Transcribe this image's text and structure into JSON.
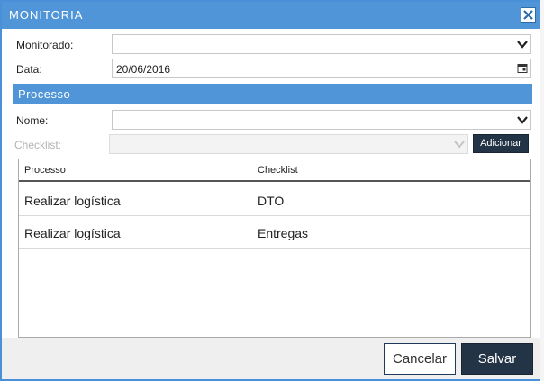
{
  "dialog": {
    "title": "MONITORIA",
    "close_icon": "close-icon"
  },
  "form": {
    "monitorado": {
      "label": "Monitorado:",
      "value": ""
    },
    "data": {
      "label": "Data:",
      "value": "20/06/2016"
    }
  },
  "processo_section": {
    "title": "Processo",
    "nome": {
      "label": "Nome:",
      "value": ""
    },
    "checklist": {
      "label": "Checklist:",
      "value": ""
    },
    "add_button": "Adicionar"
  },
  "grid": {
    "columns": [
      "Processo",
      "Checklist"
    ],
    "rows": [
      {
        "processo": "Realizar logística",
        "checklist": "DTO"
      },
      {
        "processo": "Realizar logística",
        "checklist": "Entregas"
      }
    ]
  },
  "footer": {
    "cancel_label": "Cancelar",
    "save_label": "Salvar"
  },
  "colors": {
    "accent": "#4f95d7",
    "dark_button": "#243447"
  }
}
